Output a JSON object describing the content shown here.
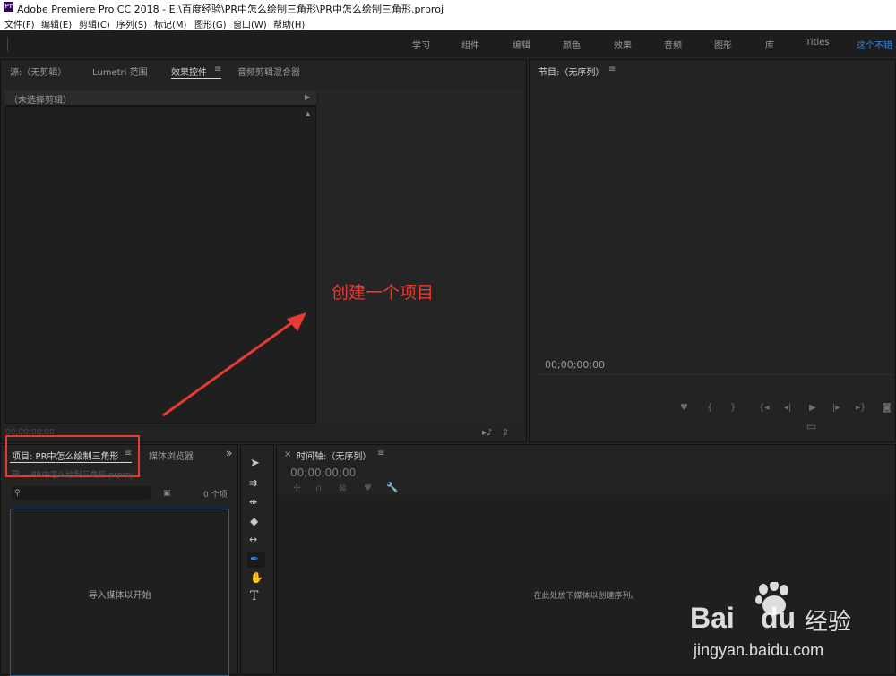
{
  "window": {
    "app_badge": "Pr",
    "title": "Adobe Premiere Pro CC 2018 - E:\\百度经验\\PR中怎么绘制三角形\\PR中怎么绘制三角形.prproj"
  },
  "menu": [
    "文件(F)",
    "编辑(E)",
    "剪辑(C)",
    "序列(S)",
    "标记(M)",
    "图形(G)",
    "窗口(W)",
    "帮助(H)"
  ],
  "workspaces": [
    "学习",
    "组件",
    "编辑",
    "颜色",
    "效果",
    "音频",
    "图形",
    "库",
    "Titles",
    "这个不错"
  ],
  "source_panel": {
    "tabs": [
      "源:（无剪辑）",
      "Lumetri 范围",
      "效果控件",
      "音频剪辑混合器"
    ],
    "active_tab": "效果控件",
    "menu_glyph": "≡",
    "no_clip": "（未选择剪辑）",
    "timecode": "00;00;00;00"
  },
  "program_panel": {
    "title": "节目:（无序列）",
    "menu_glyph": "≡",
    "timecode": "00;00;00;00"
  },
  "annotation": {
    "text": "创建一个项目",
    "color": "#e63a32"
  },
  "project_panel": {
    "tabs": [
      "项目: PR中怎么绘制三角形",
      "媒体浏览器"
    ],
    "menu_glyph": "≡",
    "overflow": "»",
    "file_name": "PR中怎么绘制三角形.prproj",
    "search_placeholder": "",
    "item_count": "0 个项",
    "empty_text": "导入媒体以开始"
  },
  "timeline_panel": {
    "close": "×",
    "title": "时间轴:（无序列）",
    "menu_glyph": "≡",
    "timecode": "00;00;00;00",
    "empty_text": "在此处放下媒体以创建序列。"
  },
  "tools": [
    "selection-tool",
    "track-select-tool",
    "ripple-edit-tool",
    "razor-tool",
    "slip-tool",
    "pen-tool",
    "hand-tool",
    "type-tool"
  ],
  "watermark": {
    "brand": "Bai",
    "brand2": "du",
    "cn": "经验",
    "url": "jingyan.baidu.com"
  },
  "colors": {
    "accent_blue": "#2d8ceb",
    "highlight_red": "#e63a32",
    "panel_bg": "#232323"
  }
}
